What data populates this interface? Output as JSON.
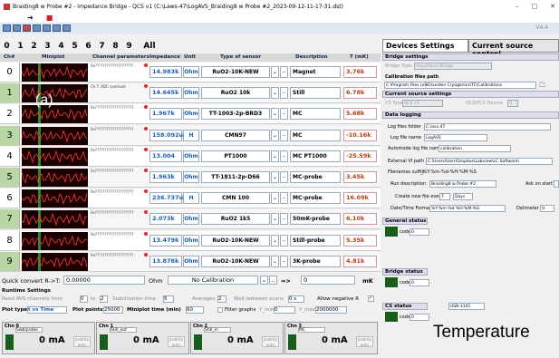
{
  "window": {
    "title": "Braiding8 w Probe #2 - Impedance Bridge - QCS v1   (C:\\Laws-47\\LogAVS_Braiding8 w Probe #2_2023-09-12-11-17-31.dst)",
    "controls": [
      "–",
      "□",
      "✕"
    ]
  },
  "toolbar": {
    "version": "V4.4"
  },
  "channel_tabs": [
    "0",
    "1",
    "2",
    "3",
    "4",
    "5",
    "6",
    "7",
    "8",
    "9",
    "All"
  ],
  "columns": {
    "ch": "Ch#",
    "miniplot": "Miniplot",
    "params": "Channel parameters",
    "impedance": "Impedance",
    "unit": "Unit",
    "sensor": "Type of sensor",
    "description": "Description",
    "temp": "T (mK)"
  },
  "rows": [
    {
      "ch": "0",
      "param": "0x????????????????????",
      "impedance": "14.983k",
      "unit": "Ohm",
      "sensor": "RuO2-10K-NEW",
      "description": "Magnet",
      "temp": "3.76k"
    },
    {
      "ch": "1",
      "param": "Ch.T: ADC overload",
      "impedance": "14.645k",
      "unit": "Ohm",
      "sensor": "RuO2 10k",
      "description": "Still",
      "temp": "6.78k"
    },
    {
      "ch": "2",
      "param": "0x????????????????????",
      "impedance": "1.967k",
      "unit": "Ohm",
      "sensor": "TT-1003-2p-BRD3",
      "description": "MC",
      "temp": "5.68k"
    },
    {
      "ch": "3",
      "param": "0x????????????????????",
      "impedance": "158.092u",
      "unit": "H",
      "sensor": "CMN97",
      "description": "MC",
      "temp": "-10.16k"
    },
    {
      "ch": "4",
      "param": "0x????????????????????",
      "impedance": "13.004",
      "unit": "Ohm",
      "sensor": "PT1000",
      "description": "MC PT1000",
      "temp": "-25.59k"
    },
    {
      "ch": "5",
      "param": "0x????????????????????",
      "impedance": "1.963k",
      "unit": "Ohm",
      "sensor": "TT-1811-2p-D66",
      "description": "MC-probe",
      "temp": "3.45k"
    },
    {
      "ch": "6",
      "param": "0x????????????????????",
      "impedance": "236.737u",
      "unit": "H",
      "sensor": "CMN 100",
      "description": "MC-probe",
      "temp": "16.09k"
    },
    {
      "ch": "7",
      "param": "0x????????????????????",
      "impedance": "2.073k",
      "unit": "Ohm",
      "sensor": "RuO2 1k5",
      "description": "50mK-probe",
      "temp": "6.10k"
    },
    {
      "ch": "8",
      "param": "0x????????????????????",
      "impedance": "13.479k",
      "unit": "Ohm",
      "sensor": "RuO2-10K-NEW",
      "description": "Still-probe",
      "temp": "5.35k"
    },
    {
      "ch": "9",
      "param": "0x????????????????????",
      "impedance": "13.878k",
      "unit": "Ohm",
      "sensor": "RuO2-10K-NEW",
      "description": "3K-probe",
      "temp": "4.81k"
    }
  ],
  "figure_label": "(a)",
  "quick_convert": {
    "label": "Quick convert R->T:",
    "value": "0.00000",
    "unit": "Ohm",
    "calibration": "No Calibration",
    "arrow": "=>",
    "result": "0",
    "result_unit": "mK"
  },
  "runtime": {
    "title": "Runtime Settings",
    "read_from": "Read AVS channels from",
    "from_val": "0",
    "to": "to",
    "to_val": "2",
    "stab": "Stabilization time",
    "stab_val": "5",
    "averages": "Averages",
    "avg_val": "2",
    "wait": "Wait between scans",
    "wait_val": "0 s",
    "neg": "Allow negative R",
    "plot_type": "Plot type",
    "plot_type_val": "t vs Time",
    "plot_points": "Plot points",
    "plot_points_val": "25000",
    "miniplot_time": "Miniplot time (min)",
    "miniplot_time_val": "60",
    "filter": "Filter graphs",
    "ymin": "Y_min",
    "ymin_val": "0",
    "ymax": "Y_max",
    "ymax_val": "2000000"
  },
  "current_channels": [
    {
      "label": "Chn 0",
      "name": "Swb/probe",
      "value": "0 mA",
      "pol": "polarity auto"
    },
    {
      "label": "Chn 1",
      "name": "Still_out",
      "value": "0 mA",
      "pol": "polarity auto"
    },
    {
      "label": "Chn 2",
      "name": "Still_in",
      "value": "0 mA",
      "pol": "polarity auto"
    },
    {
      "label": "Chn 3",
      "name": "MC",
      "value": "0 mA",
      "pol": "polarity auto"
    }
  ],
  "right_panel": {
    "tabs": [
      "Devices Settings",
      "Current source control"
    ],
    "bridge": {
      "title": "Bridge settings",
      "type_label": "Bridge Type",
      "type_val": "Impedance Bridge",
      "cal_label": "Calibration files path",
      "cal_val": "C:\\Program Files (x86)\\Leiden Cryogenics\\TC\\Calibrations"
    },
    "current": {
      "title": "Current source settings",
      "cs_label": "CS Type",
      "cs_val": "QCS v1",
      "dev_label": "QCS/PCS Device",
      "dev_val": "0"
    },
    "logging": {
      "title": "Data logging",
      "folder_label": "Log files folder",
      "folder_val": "C:\\avs-47",
      "name_label": "Log file name",
      "name_val": "LogAVS",
      "auto_label": "Automode log file name",
      "auto_val": "calibration",
      "vi_label": "External VI path",
      "vi_val": "C:\\Users\\User\\Dropbox\\Labview\\LC Software\\",
      "suffix_label": "Filenames suffix",
      "suffix_val": "_%Y-%m-%d-%H-%M-%S",
      "run_label": "Run description",
      "run_val": "Braiding8 w Probe #2",
      "ask_label": "Ask on start?",
      "every_label": "Create new file every",
      "every_val": "7",
      "every_unit": "Days",
      "date_label": "Date/Time Format",
      "date_val": "%Y-%m-%d %H:%M:%S",
      "delim_label": "Delimeter",
      "delim_val": "\\t"
    },
    "general": {
      "title": "General status",
      "code": "code",
      "code_val": "0"
    },
    "bridge_status": {
      "title": "Bridge status",
      "code": "code",
      "code_val": "0"
    },
    "cs_status": {
      "title": "CS status",
      "code": "code",
      "code_val": "0",
      "port": "USB-3101"
    }
  },
  "overlay_text": "Temperature"
}
